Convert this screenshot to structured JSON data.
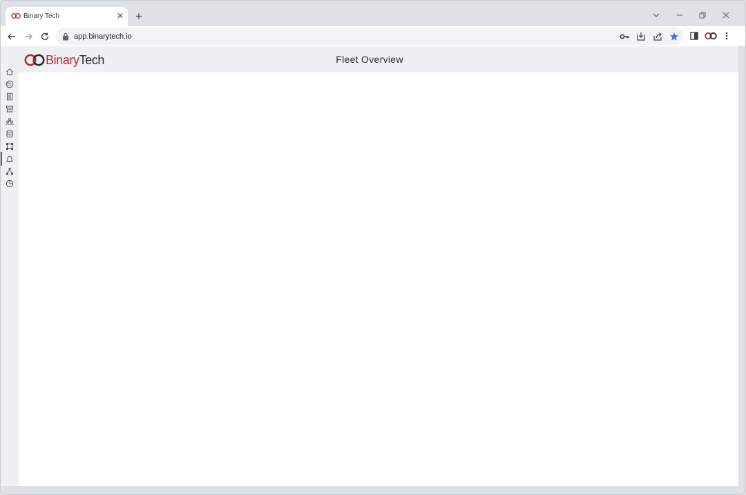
{
  "browser": {
    "tab": {
      "title": "Binary Tech"
    },
    "address": {
      "url": "app.binarytech.io"
    }
  },
  "app": {
    "logo": {
      "part1": "Binary",
      "part2": "Tech"
    },
    "page_title": "Fleet Overview",
    "sidebar": {
      "items": [
        {
          "icon": "home-icon"
        },
        {
          "icon": "globe-icon"
        },
        {
          "icon": "document-icon"
        },
        {
          "icon": "archive-icon"
        },
        {
          "icon": "users-icon"
        },
        {
          "icon": "database-icon"
        },
        {
          "icon": "nodes-icon"
        },
        {
          "icon": "bell-icon",
          "active": true
        },
        {
          "icon": "network-icon"
        },
        {
          "icon": "pie-chart-icon"
        }
      ]
    }
  },
  "colors": {
    "brand_red": "#c1272d",
    "header_bg": "#eef0f4",
    "bookmark_star": "#4d6fd8"
  }
}
